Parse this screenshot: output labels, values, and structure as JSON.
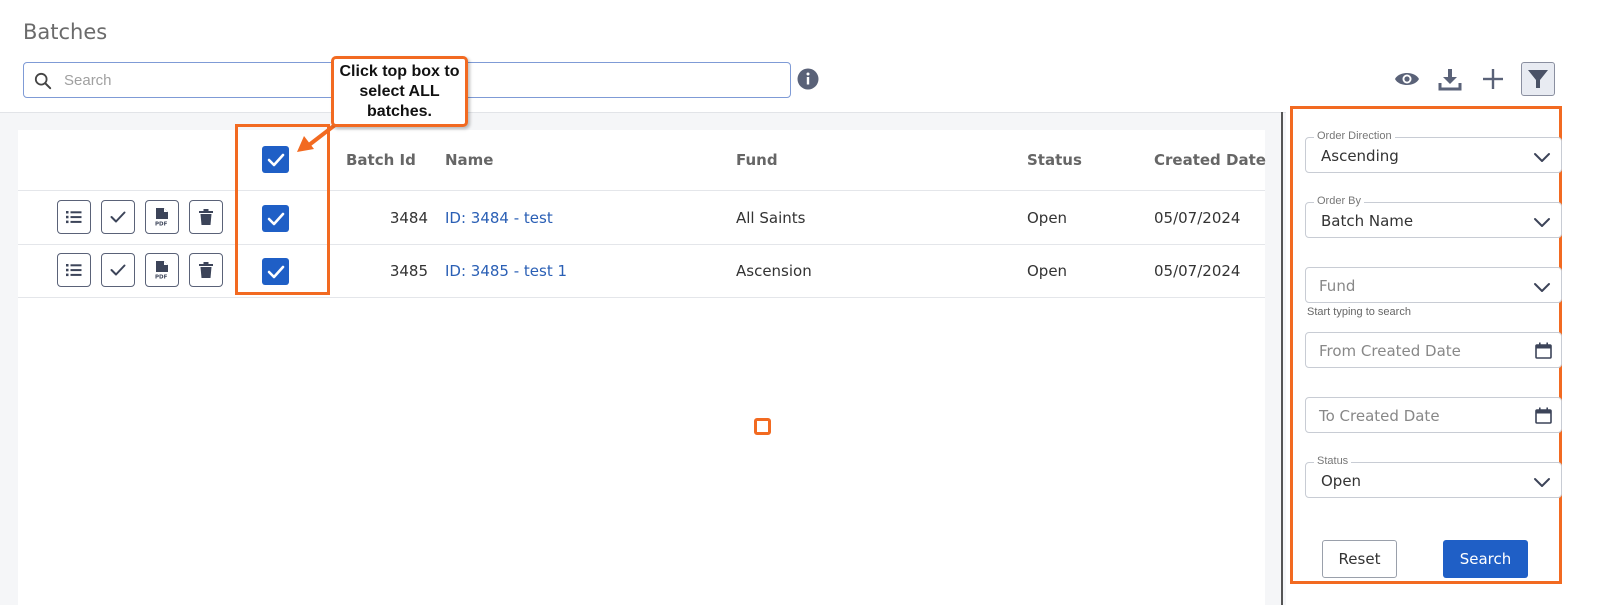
{
  "page": {
    "title": "Batches"
  },
  "search": {
    "placeholder": "Search",
    "value": ""
  },
  "toolbar": {
    "view_icon": "eye-icon",
    "download_icon": "download-icon",
    "add_icon": "plus-icon",
    "filter_icon": "filter-icon"
  },
  "table": {
    "columns": [
      "Batch Id",
      "Name",
      "Fund",
      "Status",
      "Created Date"
    ],
    "row_actions": [
      "list-icon",
      "check-icon",
      "pdf-icon",
      "trash-icon"
    ],
    "rows": [
      {
        "batch_id": "3484",
        "name": "ID: 3484 - test",
        "fund": "All Saints",
        "status": "Open",
        "created_date": "05/07/2024",
        "selected": true
      },
      {
        "batch_id": "3485",
        "name": "ID: 3485 - test 1",
        "fund": "Ascension",
        "status": "Open",
        "created_date": "05/07/2024",
        "selected": true
      }
    ],
    "select_all": true
  },
  "callout": {
    "text": "Click top box to select ALL batches."
  },
  "filters": {
    "order_direction": {
      "label": "Order Direction",
      "value": "Ascending"
    },
    "order_by": {
      "label": "Order By",
      "value": "Batch Name"
    },
    "fund": {
      "placeholder": "Fund",
      "hint": "Start typing to search"
    },
    "from_date": {
      "placeholder": "From Created Date"
    },
    "to_date": {
      "placeholder": "To Created Date"
    },
    "status": {
      "label": "Status",
      "value": "Open"
    },
    "reset_label": "Reset",
    "search_label": "Search"
  },
  "colors": {
    "accent": "#1f5fc6",
    "annotation": "#f26a21",
    "link": "#2a5fb5"
  }
}
